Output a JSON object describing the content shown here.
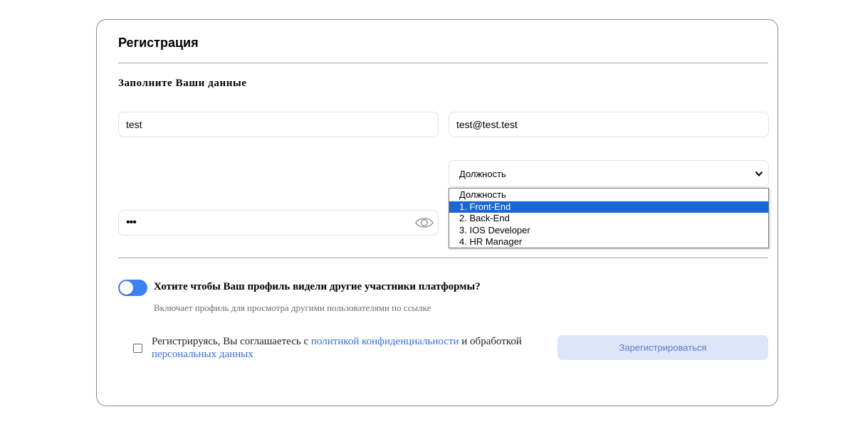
{
  "form": {
    "title": "Регистрация",
    "subtitle": "Заполните Ваши данные",
    "name_value": "test",
    "email_value": "test@test.test",
    "password_value": "•••",
    "position_select": {
      "selected": "Должность",
      "options": [
        "Должность",
        "1. Front-End",
        "2. Back-End",
        "3. IOS Developer",
        "4. HR Manager"
      ],
      "highlighted_option": "1. Front-End"
    },
    "visibility_question": "Хотите чтобы Ваш профиль видели другие участники платформы?",
    "visibility_desc": "Включает профиль для просмотра другими пользователями по ссылке",
    "agree_text_1": "Регистрируясь, Вы соглашаетесь с ",
    "privacy_link": "политикой конфиденциальности",
    "agree_text_2": " и обработкой ",
    "personal_data_link": "персональных данных",
    "submit_label": "Зарегистрироваться"
  },
  "colors": {
    "accent": "#3b82f6",
    "link": "#3b6fd4",
    "option_highlight": "#1967d2",
    "submit_bg": "#dde6f8",
    "submit_text": "#5b7ccd"
  },
  "icons": {
    "password_toggle": "eye-icon",
    "select_arrow": "chevron-down-icon"
  }
}
